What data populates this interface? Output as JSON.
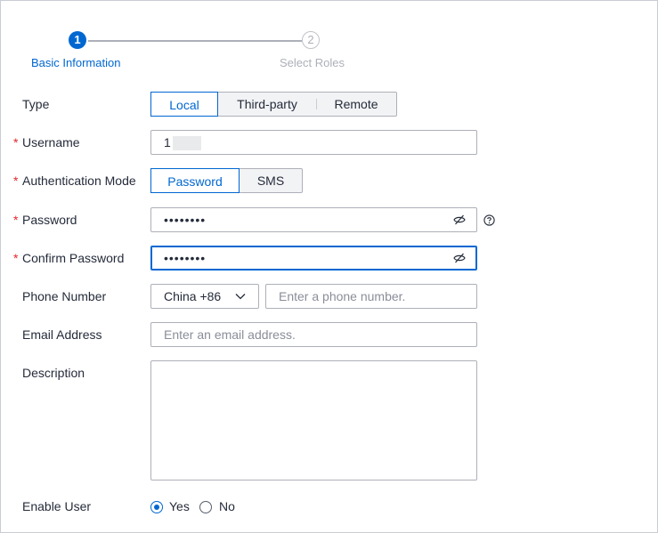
{
  "stepper": {
    "steps": [
      {
        "number": "1",
        "label": "Basic Information"
      },
      {
        "number": "2",
        "label": "Select Roles"
      }
    ]
  },
  "form": {
    "type": {
      "label": "Type",
      "options": [
        "Local",
        "Third-party",
        "Remote"
      ],
      "selected": "Local"
    },
    "username": {
      "label": "Username",
      "required_mark": "*",
      "value": "1"
    },
    "auth_mode": {
      "label": "Authentication Mode",
      "required_mark": "*",
      "options": [
        "Password",
        "SMS"
      ],
      "selected": "Password"
    },
    "password": {
      "label": "Password",
      "required_mark": "*",
      "value": "••••••••",
      "help_icon": "question-circle-icon",
      "toggle_icon": "eye-off-icon"
    },
    "confirm_password": {
      "label": "Confirm Password",
      "required_mark": "*",
      "value": "••••••••",
      "toggle_icon": "eye-off-icon"
    },
    "phone": {
      "label": "Phone Number",
      "country": "China +86",
      "placeholder": "Enter a phone number."
    },
    "email": {
      "label": "Email Address",
      "placeholder": "Enter an email address."
    },
    "description": {
      "label": "Description"
    },
    "enable_user": {
      "label": "Enable User",
      "options": [
        "Yes",
        "No"
      ],
      "selected": "Yes"
    }
  },
  "colors": {
    "accent": "#0067d1",
    "required": "#e5262c",
    "border": "#adb0b8"
  }
}
